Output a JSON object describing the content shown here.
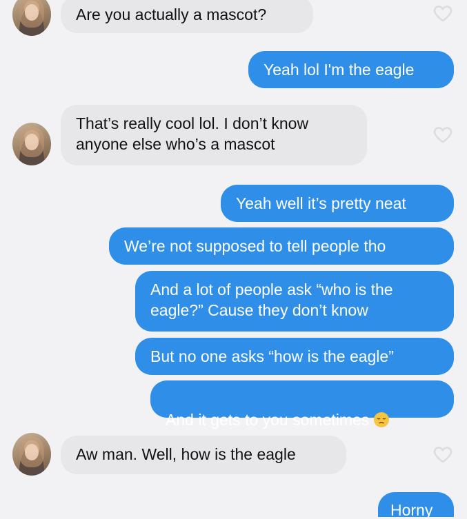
{
  "messages": {
    "m1": "Are you actually a mascot?",
    "m2": "Yeah lol I'm the eagle",
    "m3": "That’s really cool lol. I don’t know\nanyone else who’s a mascot",
    "m4": "Yeah well it’s pretty neat",
    "m5": "We’re not supposed to tell people tho",
    "m6": "And a lot of people ask “who is the\neagle?” Cause they don’t know",
    "m7": "But no one asks “how is the eagle”",
    "m8": "And it gets to you sometimes",
    "m9": "Aw man. Well, how is the eagle",
    "m10": "Horny"
  },
  "emoji": {
    "m8": "pensive-face-emoji"
  },
  "colors": {
    "background": "#f2f2f4",
    "incoming_bubble": "#e7e7ea",
    "outgoing_bubble": "#2f8fe8",
    "outgoing_text": "#ffffff",
    "like_heart": "#dcdcdf"
  }
}
